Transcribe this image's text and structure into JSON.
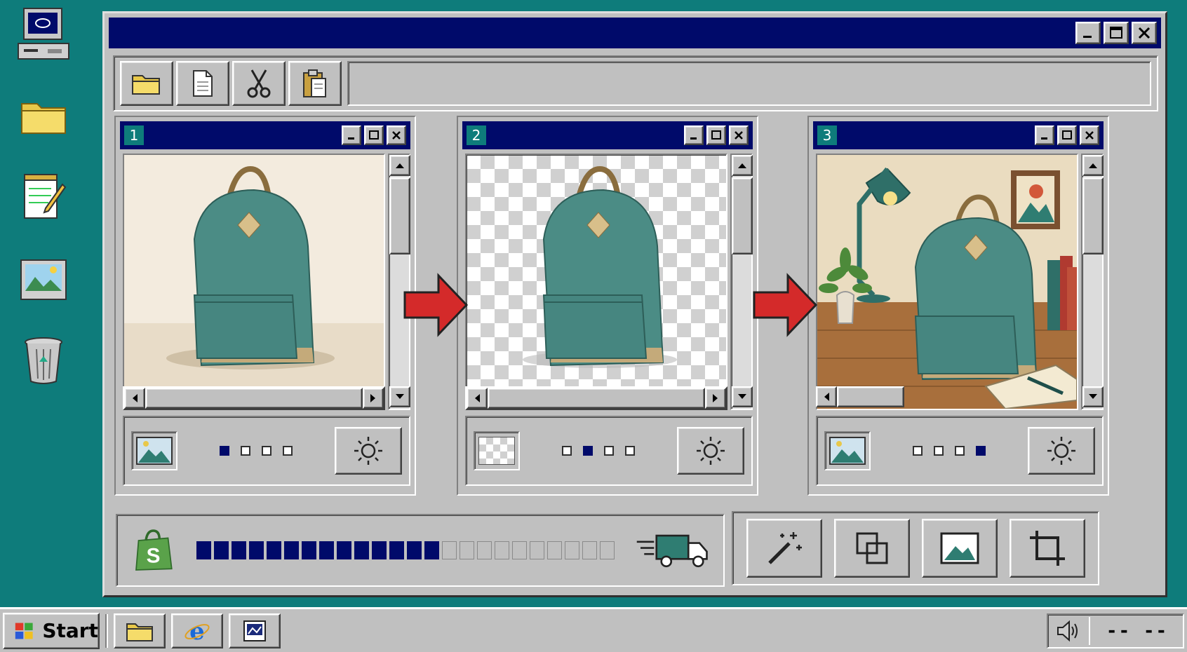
{
  "desktop": {
    "icons": [
      {
        "name": "my-computer-icon"
      },
      {
        "name": "folder-icon"
      },
      {
        "name": "notepad-icon"
      },
      {
        "name": "picture-icon"
      },
      {
        "name": "recycle-bin-icon"
      }
    ]
  },
  "window": {
    "title": "",
    "controls": [
      "minimize",
      "maximize",
      "close"
    ]
  },
  "toolbar": {
    "buttons": [
      "open-folder",
      "new-document",
      "cut",
      "paste"
    ]
  },
  "panels": [
    {
      "number": "1",
      "image": "backpack-original",
      "active_dot": 0,
      "thumb": "picture-icon"
    },
    {
      "number": "2",
      "image": "backpack-background-removed",
      "active_dot": 1,
      "thumb": "transparency-icon"
    },
    {
      "number": "3",
      "image": "backpack-lifestyle-scene",
      "active_dot": 3,
      "thumb": "picture-icon"
    }
  ],
  "status": {
    "logo": "shopify-bag-icon",
    "logo_letter": "S",
    "progress_filled": 14,
    "progress_total": 24,
    "delivery_icon": "delivery-truck-icon"
  },
  "actions": [
    "magic-wand",
    "layers",
    "image",
    "crop"
  ],
  "taskbar": {
    "start_label": "Start",
    "apps": [
      "folder",
      "internet-explorer",
      "image-viewer"
    ],
    "clock": "-- --"
  },
  "colors": {
    "desktop": "#0e7c7b",
    "titlebar": "#000a6a",
    "chrome": "#c0c0c0",
    "arrow": "#d42a2a",
    "backpack": "#4b8c85"
  }
}
